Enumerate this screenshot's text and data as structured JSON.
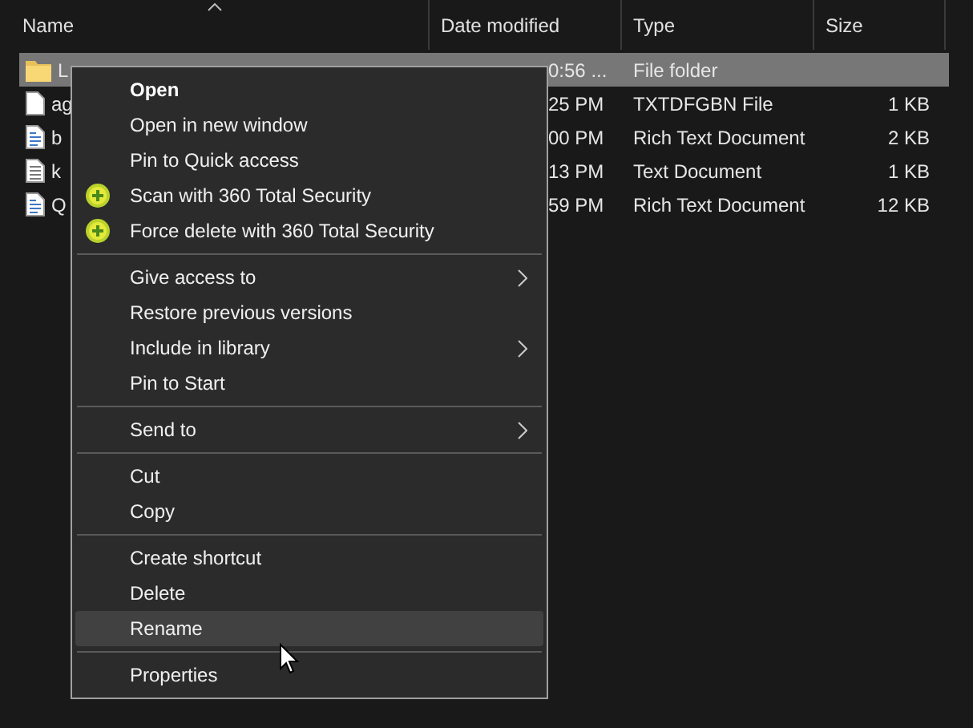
{
  "columns": [
    {
      "label": "Name",
      "sorted": true
    },
    {
      "label": "Date modified",
      "sorted": false
    },
    {
      "label": "Type",
      "sorted": false
    },
    {
      "label": "Size",
      "sorted": false
    }
  ],
  "rows": [
    {
      "kind": "folder",
      "name": "L",
      "date": "0:56 ...",
      "type": "File folder",
      "size": "",
      "selected": true
    },
    {
      "kind": "file",
      "name": "ag",
      "date": "25 PM",
      "type": "TXTDFGBN File",
      "size": "1 KB",
      "selected": false
    },
    {
      "kind": "rich",
      "name": "b",
      "date": "00 PM",
      "type": "Rich Text Document",
      "size": "2 KB",
      "selected": false
    },
    {
      "kind": "text",
      "name": "k",
      "date": "13 PM",
      "type": "Text Document",
      "size": "1 KB",
      "selected": false
    },
    {
      "kind": "rich",
      "name": "Q",
      "date": "59 PM",
      "type": "Rich Text Document",
      "size": "12 KB",
      "selected": false
    }
  ],
  "context_menu": {
    "sections": [
      [
        {
          "label": "Open",
          "default": true,
          "icon": false,
          "submenu": false,
          "selected": false
        },
        {
          "label": "Open in new window",
          "default": false,
          "icon": false,
          "submenu": false,
          "selected": false
        },
        {
          "label": "Pin to Quick access",
          "default": false,
          "icon": false,
          "submenu": false,
          "selected": false
        },
        {
          "label": "Scan with 360 Total Security",
          "default": false,
          "icon": true,
          "submenu": false,
          "selected": false
        },
        {
          "label": "Force delete with 360 Total Security",
          "default": false,
          "icon": true,
          "submenu": false,
          "selected": false
        }
      ],
      [
        {
          "label": "Give access to",
          "default": false,
          "icon": false,
          "submenu": true,
          "selected": false
        },
        {
          "label": "Restore previous versions",
          "default": false,
          "icon": false,
          "submenu": false,
          "selected": false
        },
        {
          "label": "Include in library",
          "default": false,
          "icon": false,
          "submenu": true,
          "selected": false
        },
        {
          "label": "Pin to Start",
          "default": false,
          "icon": false,
          "submenu": false,
          "selected": false
        }
      ],
      [
        {
          "label": "Send to",
          "default": false,
          "icon": false,
          "submenu": true,
          "selected": false
        }
      ],
      [
        {
          "label": "Cut",
          "default": false,
          "icon": false,
          "submenu": false,
          "selected": false
        },
        {
          "label": "Copy",
          "default": false,
          "icon": false,
          "submenu": false,
          "selected": false
        }
      ],
      [
        {
          "label": "Create shortcut",
          "default": false,
          "icon": false,
          "submenu": false,
          "selected": false
        },
        {
          "label": "Delete",
          "default": false,
          "icon": false,
          "submenu": false,
          "selected": false
        },
        {
          "label": "Rename",
          "default": false,
          "icon": false,
          "submenu": false,
          "selected": true
        }
      ],
      [
        {
          "label": "Properties",
          "default": false,
          "icon": false,
          "submenu": false,
          "selected": false
        }
      ]
    ]
  }
}
